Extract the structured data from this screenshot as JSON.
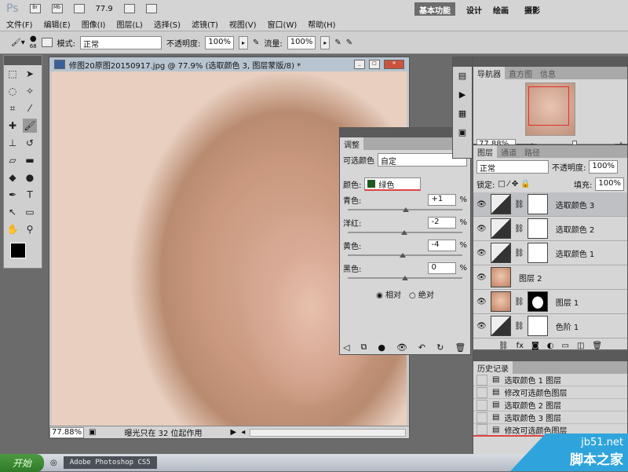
{
  "appbar": {
    "logo": "Ps",
    "zoom": "77.9",
    "workspaces": [
      "基本功能",
      "设计",
      "绘画",
      "摄影"
    ],
    "active_workspace": "基本功能"
  },
  "menu": [
    "文件(F)",
    "编辑(E)",
    "图像(I)",
    "图层(L)",
    "选择(S)",
    "滤镜(T)",
    "视图(V)",
    "窗口(W)",
    "帮助(H)"
  ],
  "options": {
    "brush_size": "68",
    "mode_label": "模式:",
    "mode_value": "正常",
    "opacity_label": "不透明度:",
    "opacity_value": "100%",
    "flow_label": "流量:",
    "flow_value": "100%"
  },
  "document": {
    "title": "修图20原图20150917.jpg @ 77.9% (选取颜色 3, 图层蒙版/8) *",
    "zoom": "77.88%",
    "status": "曝光只在 32 位起作用"
  },
  "adjustments": {
    "tab": "调整",
    "preset_label": "可选颜色",
    "preset_value": "自定",
    "color_label": "颜色:",
    "color_value": "绿色",
    "swatch": "#1f5a1f",
    "sliders": [
      {
        "label": "青色:",
        "value": "+1",
        "level": 1
      },
      {
        "label": "洋红:",
        "value": "-2",
        "level": -2
      },
      {
        "label": "黄色:",
        "value": "-4",
        "level": -4
      },
      {
        "label": "黑色:",
        "value": "0",
        "level": 0
      }
    ],
    "unit": "%",
    "method_relative": "相对",
    "method_absolute": "绝对",
    "selected_method": "相对"
  },
  "navigator": {
    "tabs": [
      "导航器",
      "直方图",
      "信息"
    ],
    "zoom": "77.88%"
  },
  "layers": {
    "tabs": [
      "图层",
      "通道",
      "路径"
    ],
    "blend": "正常",
    "opacity_label": "不透明度:",
    "opacity": "100%",
    "lock_label": "锁定:",
    "fill_label": "填充:",
    "fill": "100%",
    "items": [
      {
        "name": "选取颜色 3",
        "type": "adj",
        "selected": true
      },
      {
        "name": "选取颜色 2",
        "type": "adj"
      },
      {
        "name": "选取颜色 1",
        "type": "adj"
      },
      {
        "name": "图层 2",
        "type": "face"
      },
      {
        "name": "图层 1",
        "type": "face-mask"
      },
      {
        "name": "色阶 1",
        "type": "adj"
      }
    ]
  },
  "history": {
    "tab": "历史记录",
    "items": [
      "选取颜色 1 图层",
      "修改可选颜色图层",
      "选取颜色 2 图层",
      "选取颜色 3 图层",
      "修改可选颜色图层"
    ]
  },
  "taskbar": {
    "start": "开始",
    "app": "Adobe Photoshop CS5"
  },
  "watermark": {
    "site": "jb51.net",
    "name": "脚本之家"
  }
}
